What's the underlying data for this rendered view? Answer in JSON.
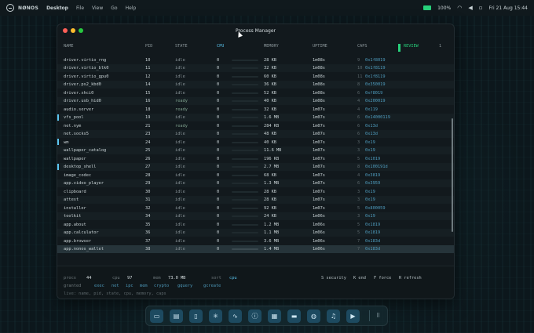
{
  "topbar": {
    "brand": "NØNOS",
    "workspace": "Desktop",
    "menus": [
      "File",
      "View",
      "Go",
      "Help"
    ],
    "battery": "100%",
    "clock": "Fri 21 Aug  15:44",
    "battery_color": "#27d07a"
  },
  "window": {
    "title": "Process Manager",
    "dot_colors": [
      "#ff5f57",
      "#febc2e",
      "#28c840"
    ]
  },
  "table": {
    "headers": {
      "name": "NAME",
      "pid": "PID",
      "state": "STATE",
      "cpu": "CPU",
      "memory": "MEMORY",
      "uptime": "UPTIME",
      "caps": "CAPS",
      "review": "REVIEW",
      "review_count": "1"
    },
    "rows": [
      {
        "name": "driver.virtio_rng",
        "pid": "10",
        "state": "idle",
        "cpu": "0",
        "memory": "28 KB",
        "uptime": "1m08s",
        "caps_n": "9",
        "caps_v": "0x1f8019"
      },
      {
        "name": "driver.virtio_blk0",
        "pid": "11",
        "state": "idle",
        "cpu": "0",
        "memory": "32 KB",
        "uptime": "1m08s",
        "caps_n": "10",
        "caps_v": "0x1f8119"
      },
      {
        "name": "driver.virtio_gpu0",
        "pid": "12",
        "state": "idle",
        "cpu": "0",
        "memory": "60 KB",
        "uptime": "1m08s",
        "caps_n": "11",
        "caps_v": "0x1f8119"
      },
      {
        "name": "driver.ps2_kbd0",
        "pid": "14",
        "state": "idle",
        "cpu": "0",
        "memory": "36 KB",
        "uptime": "1m08s",
        "caps_n": "8",
        "caps_v": "0x350019"
      },
      {
        "name": "driver.xhci0",
        "pid": "15",
        "state": "idle",
        "cpu": "0",
        "memory": "52 KB",
        "uptime": "1m08s",
        "caps_n": "6",
        "caps_v": "0xf8019"
      },
      {
        "name": "driver.usb_hid0",
        "pid": "16",
        "state": "ready",
        "cpu": "0",
        "memory": "40 KB",
        "uptime": "1m08s",
        "caps_n": "4",
        "caps_v": "0x200019"
      },
      {
        "name": "audio.server",
        "pid": "18",
        "state": "ready",
        "cpu": "0",
        "memory": "32 KB",
        "uptime": "1m07s",
        "caps_n": "4",
        "caps_v": "0x119"
      },
      {
        "name": "vfs_pool",
        "pid": "19",
        "state": "idle",
        "cpu": "0",
        "memory": "1.6 MB",
        "uptime": "1m07s",
        "caps_n": "6",
        "caps_v": "0x14000119"
      },
      {
        "name": "net.nym",
        "pid": "21",
        "state": "ready",
        "cpu": "0",
        "memory": "284 KB",
        "uptime": "1m07s",
        "caps_n": "6",
        "caps_v": "0x13d"
      },
      {
        "name": "net.socks5",
        "pid": "23",
        "state": "idle",
        "cpu": "0",
        "memory": "48 KB",
        "uptime": "1m07s",
        "caps_n": "6",
        "caps_v": "0x13d"
      },
      {
        "name": "wm",
        "pid": "24",
        "state": "idle",
        "cpu": "0",
        "memory": "40 KB",
        "uptime": "1m07s",
        "caps_n": "3",
        "caps_v": "0x19"
      },
      {
        "name": "wallpaper_catalog",
        "pid": "25",
        "state": "idle",
        "cpu": "0",
        "memory": "11.6 MB",
        "uptime": "1m07s",
        "caps_n": "3",
        "caps_v": "0x19"
      },
      {
        "name": "wallpaper",
        "pid": "26",
        "state": "idle",
        "cpu": "0",
        "memory": "196 KB",
        "uptime": "1m07s",
        "caps_n": "5",
        "caps_v": "0x1019"
      },
      {
        "name": "desktop_shell",
        "pid": "27",
        "state": "idle",
        "cpu": "0",
        "memory": "2.7 MB",
        "uptime": "1m07s",
        "caps_n": "8",
        "caps_v": "0x100191d"
      },
      {
        "name": "image_codec",
        "pid": "28",
        "state": "idle",
        "cpu": "0",
        "memory": "68 KB",
        "uptime": "1m07s",
        "caps_n": "4",
        "caps_v": "0x3819"
      },
      {
        "name": "app.video_player",
        "pid": "29",
        "state": "idle",
        "cpu": "0",
        "memory": "1.3 MB",
        "uptime": "1m07s",
        "caps_n": "6",
        "caps_v": "0x3959"
      },
      {
        "name": "clipboard",
        "pid": "30",
        "state": "idle",
        "cpu": "0",
        "memory": "28 KB",
        "uptime": "1m07s",
        "caps_n": "3",
        "caps_v": "0x19"
      },
      {
        "name": "attest",
        "pid": "31",
        "state": "idle",
        "cpu": "0",
        "memory": "28 KB",
        "uptime": "1m07s",
        "caps_n": "3",
        "caps_v": "0x19"
      },
      {
        "name": "installer",
        "pid": "32",
        "state": "idle",
        "cpu": "0",
        "memory": "92 KB",
        "uptime": "1m07s",
        "caps_n": "5",
        "caps_v": "0x800059"
      },
      {
        "name": "toolkit",
        "pid": "34",
        "state": "idle",
        "cpu": "0",
        "memory": "24 KB",
        "uptime": "1m06s",
        "caps_n": "3",
        "caps_v": "0x19"
      },
      {
        "name": "app.about",
        "pid": "35",
        "state": "idle",
        "cpu": "0",
        "memory": "1.2 MB",
        "uptime": "1m06s",
        "caps_n": "5",
        "caps_v": "0x1819"
      },
      {
        "name": "app.calculator",
        "pid": "36",
        "state": "idle",
        "cpu": "0",
        "memory": "1.1 MB",
        "uptime": "1m06s",
        "caps_n": "5",
        "caps_v": "0x1819"
      },
      {
        "name": "app.browser",
        "pid": "37",
        "state": "idle",
        "cpu": "0",
        "memory": "3.6 MB",
        "uptime": "1m06s",
        "caps_n": "7",
        "caps_v": "0x183d"
      },
      {
        "name": "app.nonos_wallet",
        "pid": "38",
        "state": "idle",
        "cpu": "0",
        "memory": "1.4 MB",
        "uptime": "1m06s",
        "caps_n": "7",
        "caps_v": "0x183d"
      }
    ],
    "selected_row": 23
  },
  "footer": {
    "procs_label": "procs",
    "procs_value": "44",
    "cpu_label": "cpu",
    "cpu_value": "97",
    "mem_label": "mem",
    "mem_value": "73.0 MB",
    "sort_label": "sort",
    "sort_value": "cpu",
    "granted_label": "granted",
    "granted": [
      "exec",
      "net",
      "ipc",
      "mem",
      "crypto",
      "gquery",
      "gcreate"
    ],
    "hints": [
      "S security",
      "K end",
      "F force",
      "R refresh"
    ],
    "live": "live: name, pid, state, cpu, memory, caps"
  },
  "dock": {
    "icons": [
      "terminal-icon",
      "folder-icon",
      "document-icon",
      "settings-icon",
      "activity-icon",
      "info-icon",
      "clipboard-icon",
      "wallet-icon",
      "globe-icon",
      "music-icon",
      "video-icon"
    ],
    "glyphs": [
      "▭",
      "▤",
      "▯",
      "✳",
      "∿",
      "ⓘ",
      "▦",
      "▬",
      "◍",
      "♫",
      "▶"
    ]
  }
}
